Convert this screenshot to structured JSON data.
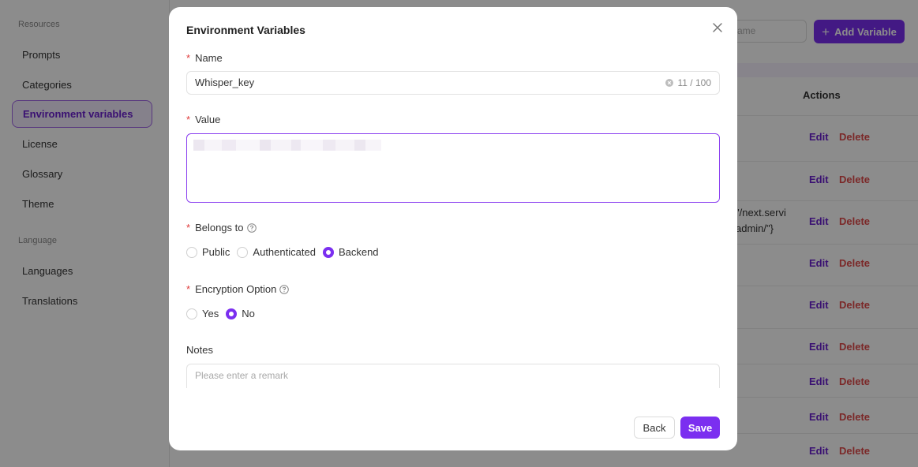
{
  "sidebar": {
    "resources_heading": "Resources",
    "items": [
      {
        "label": "Prompts"
      },
      {
        "label": "Categories"
      },
      {
        "label": "Environment variables"
      },
      {
        "label": "License"
      },
      {
        "label": "Glossary"
      },
      {
        "label": "Theme"
      }
    ],
    "language_heading": "Language",
    "language_items": [
      {
        "label": "Languages"
      },
      {
        "label": "Translations"
      }
    ]
  },
  "main": {
    "search_placeholder_fragment": "ame",
    "add_button_label": "Add Variable",
    "actions_header": "Actions",
    "edit_label": "Edit",
    "delete_label": "Delete",
    "row_fragment_line1": "\"/next.servi",
    "row_fragment_line2": "admin/\"}"
  },
  "modal": {
    "title": "Environment Variables",
    "name_label": "Name",
    "name_value": "Whisper_key",
    "name_counter": "11 / 100",
    "value_label": "Value",
    "belongs_label": "Belongs to",
    "belongs_options": [
      "Public",
      "Authenticated",
      "Backend"
    ],
    "belongs_selected": "Backend",
    "encryption_label": "Encryption Option",
    "encryption_options": [
      "Yes",
      "No"
    ],
    "encryption_selected": "No",
    "notes_label": "Notes",
    "notes_placeholder": "Please enter a remark",
    "back_label": "Back",
    "save_label": "Save"
  },
  "colors": {
    "accent": "#7b2ff0",
    "danger": "#e04a4a",
    "required": "#e03a3a"
  }
}
